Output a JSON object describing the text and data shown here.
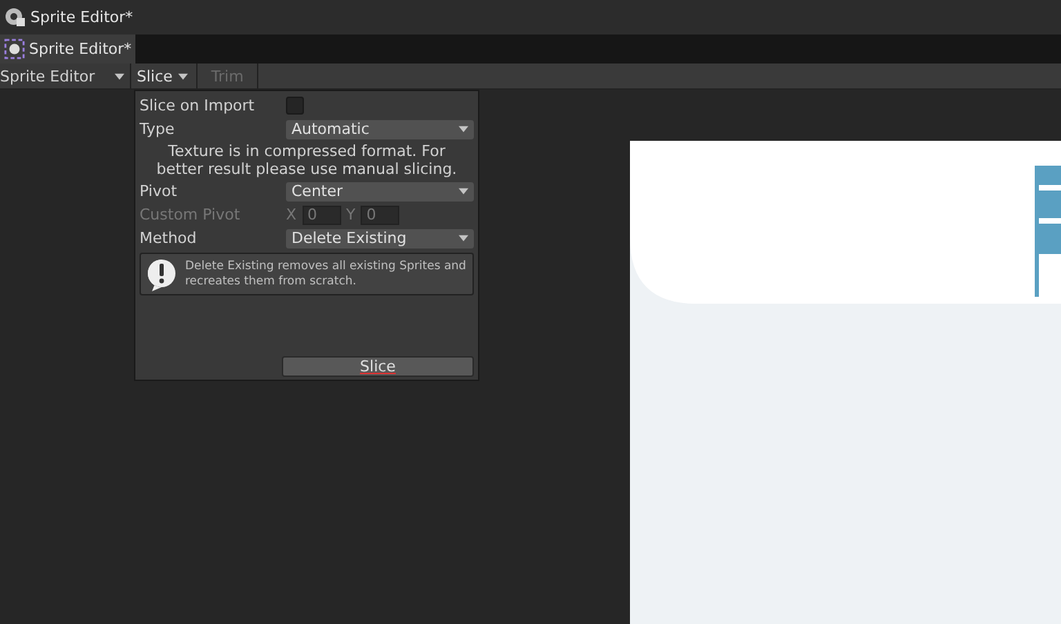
{
  "window": {
    "title": "Sprite Editor*"
  },
  "tab": {
    "label": "Sprite Editor*",
    "selected": true
  },
  "toolbar": {
    "mode": "Sprite Editor",
    "slice_menu": "Slice",
    "trim": {
      "label": "Trim",
      "disabled": true
    }
  },
  "slice_popup": {
    "rows": [
      {
        "kind": "checkbox",
        "label": "Slice on Import",
        "checked": false
      },
      {
        "kind": "dropdown",
        "label": "Type",
        "value": "Automatic"
      },
      {
        "kind": "note",
        "text": "Texture is in compressed format. For better result please use manual slicing."
      },
      {
        "kind": "dropdown",
        "label": "Pivot",
        "value": "Center"
      },
      {
        "kind": "xy",
        "label": "Custom Pivot",
        "disabled": true,
        "x_label": "X",
        "x_value": "0",
        "y_label": "Y",
        "y_value": "0"
      },
      {
        "kind": "dropdown",
        "label": "Method",
        "value": "Delete Existing"
      },
      {
        "kind": "info",
        "text": "Delete Existing removes all existing Sprites and recreates them from scratch."
      }
    ],
    "button": "Slice"
  }
}
